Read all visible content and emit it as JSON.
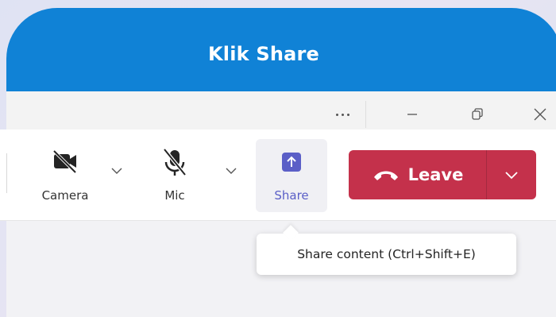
{
  "banner": {
    "title": "Klik Share"
  },
  "titlebar": {
    "more_icon": "more-horizontal-icon",
    "minimize_icon": "minimize-icon",
    "restore_icon": "restore-icon",
    "close_icon": "close-icon"
  },
  "toolbar": {
    "camera": {
      "label": "Camera",
      "icon": "camera-off-icon"
    },
    "mic": {
      "label": "Mic",
      "icon": "mic-off-icon"
    },
    "share": {
      "label": "Share",
      "icon": "share-arrow-icon"
    },
    "leave": {
      "label": "Leave",
      "icon": "phone-hangup-icon"
    }
  },
  "tooltip": {
    "text": "Share content (Ctrl+Shift+E)"
  },
  "colors": {
    "banner": "#1082d6",
    "leave": "#c4314b",
    "share_accent": "#5b5fc7"
  }
}
